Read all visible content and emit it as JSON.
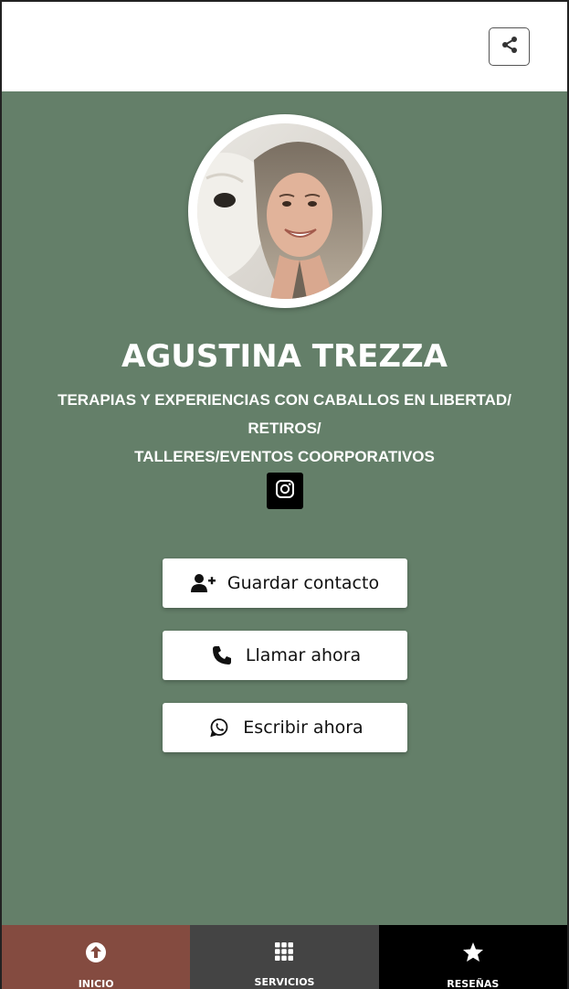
{
  "profile": {
    "name": "AGUSTINA TREZZA",
    "subtitle_line1": "TERAPIAS Y EXPERIENCIAS CON CABALLOS EN LIBERTAD/ RETIROS/",
    "subtitle_line2": "TALLERES/EVENTOS COORPORATIVOS"
  },
  "actions": {
    "save_contact": "Guardar contacto",
    "call_now": "Llamar ahora",
    "write_now": "Escribir ahora"
  },
  "nav": {
    "home": "INICIO",
    "services": "SERVICIOS",
    "reviews": "RESEÑAS"
  },
  "colors": {
    "main_bg": "#647f69",
    "nav_home": "#844b40",
    "nav_services": "#444444",
    "nav_reviews": "#000000"
  },
  "icons": {
    "share": "share-icon",
    "instagram": "instagram-icon",
    "save_contact": "user-plus-icon",
    "call": "phone-icon",
    "whatsapp": "whatsapp-icon",
    "home": "arrow-up-circle-icon",
    "services": "grid-icon",
    "reviews": "star-icon"
  }
}
